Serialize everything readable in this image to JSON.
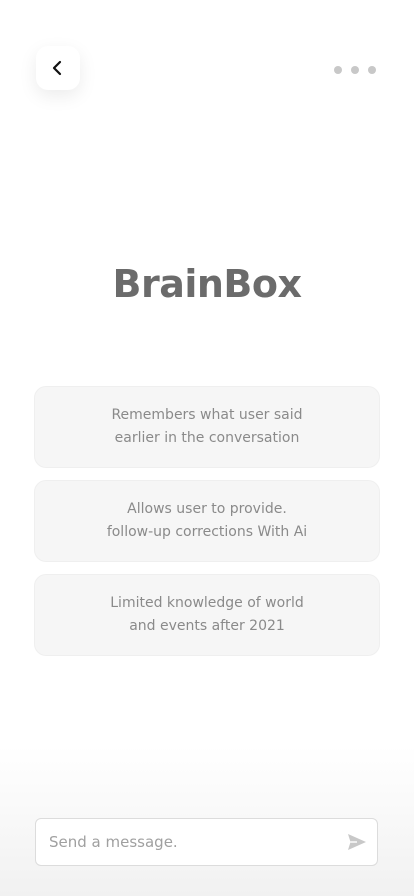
{
  "header": {
    "back_icon": "chevron-left-icon",
    "more_icon": "more-horizontal-icon"
  },
  "title": "BrainBox",
  "cards": [
    {
      "text": "Remembers what user said\nearlier in the conversation"
    },
    {
      "text": "Allows user to provide.\nfollow-up corrections With Ai"
    },
    {
      "text": "Limited knowledge of world\nand events after 2021"
    }
  ],
  "composer": {
    "placeholder": "Send a message.",
    "value": "",
    "send_icon": "send-icon"
  },
  "colors": {
    "title": "#6b6b6b",
    "card_bg": "#f6f6f6",
    "card_text": "#8a8a8a",
    "icon_dark": "#111111",
    "icon_muted": "#c8c8c8"
  }
}
